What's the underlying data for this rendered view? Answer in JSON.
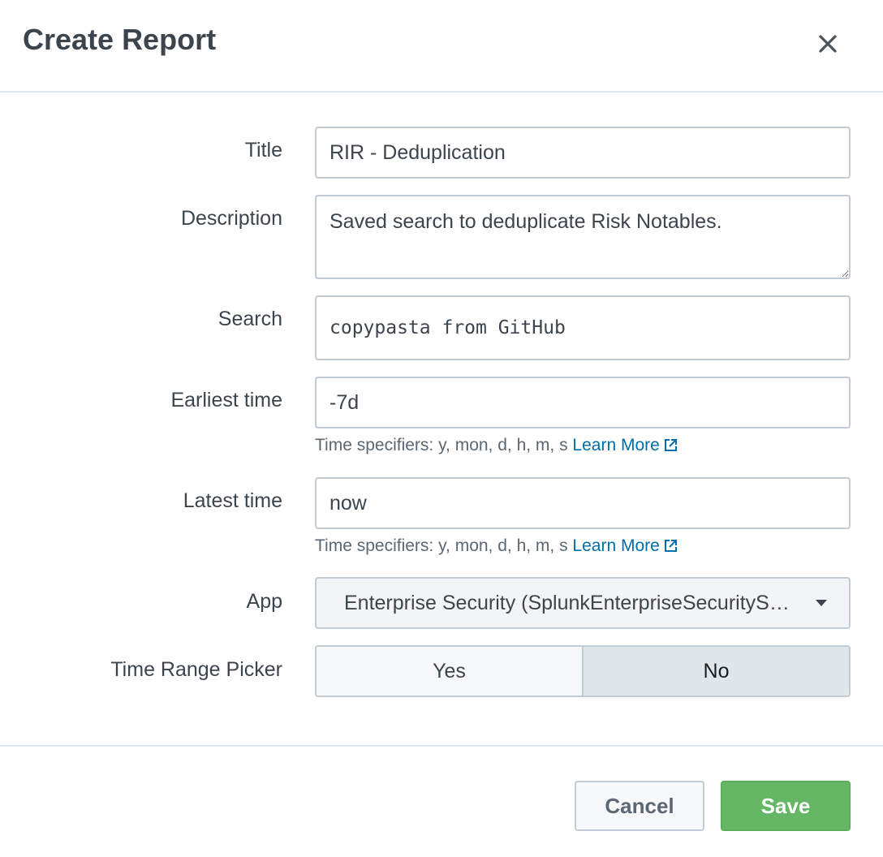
{
  "dialog": {
    "title": "Create Report",
    "close_icon": "close-icon"
  },
  "form": {
    "title": {
      "label": "Title",
      "value": "RIR - Deduplication"
    },
    "description": {
      "label": "Description",
      "value": "Saved search to deduplicate Risk Notables."
    },
    "search": {
      "label": "Search",
      "value": "copypasta from GitHub"
    },
    "earliest_time": {
      "label": "Earliest time",
      "value": "-7d",
      "help": "Time specifiers: y, mon, d, h, m, s",
      "link": "Learn More"
    },
    "latest_time": {
      "label": "Latest time",
      "value": "now",
      "help": "Time specifiers: y, mon, d, h, m, s",
      "link": "Learn More"
    },
    "app": {
      "label": "App",
      "selected": "Enterprise Security (SplunkEnterpriseSecuritySuite)"
    },
    "time_range_picker": {
      "label": "Time Range Picker",
      "options": [
        "Yes",
        "No"
      ],
      "selected": "No"
    }
  },
  "footer": {
    "cancel_label": "Cancel",
    "save_label": "Save"
  },
  "colors": {
    "primary_text": "#3c444d",
    "link": "#006eaa",
    "save_button": "#65b665",
    "border": "#c3cbd4",
    "divider": "#e1e6eb"
  }
}
